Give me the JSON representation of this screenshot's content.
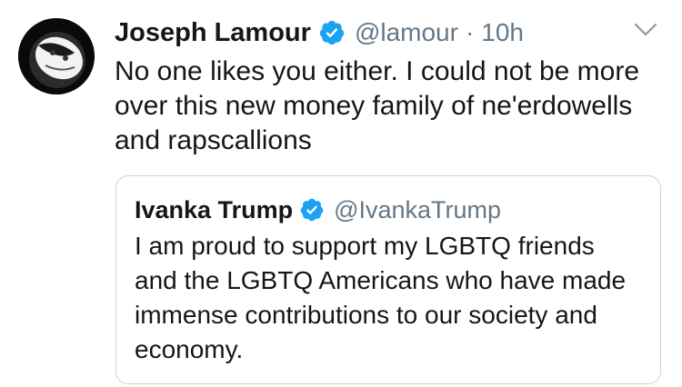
{
  "tweet": {
    "author": {
      "name": "Joseph Lamour",
      "handle": "@lamour",
      "verified_icon": "verified-badge-icon",
      "avatar_icon": "profile-avatar"
    },
    "separator": "·",
    "time": "10h",
    "menu_icon": "chevron-down-icon",
    "text": "No one likes you either. I could not be more over this new money family of ne'erdowells and rapscallions"
  },
  "quoted_tweet": {
    "author": {
      "name": "Ivanka Trump",
      "handle": "@IvankaTrump",
      "verified_icon": "verified-badge-icon"
    },
    "text": "I am proud to support my LGBTQ friends and the LGBTQ Americans who have made immense contributions to our society and economy."
  },
  "colors": {
    "text_primary": "#14171a",
    "text_secondary": "#657786",
    "verified_blue": "#1da1f2",
    "border": "#ccd6dd"
  }
}
